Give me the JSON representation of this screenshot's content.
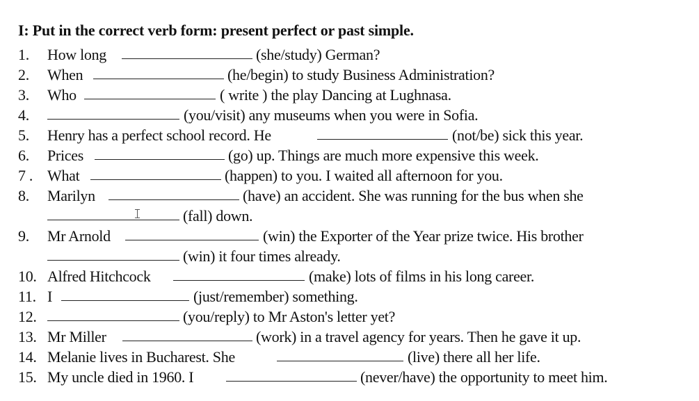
{
  "worksheet": {
    "title": "I:  Put in the correct verb form: present perfect or past simple.",
    "items": [
      {
        "number": "1.",
        "before": "How long",
        "hint": "(she/study) German?"
      },
      {
        "number": "2.",
        "before": "When",
        "hint": "(he/begin) to study Business Administration?"
      },
      {
        "number": "3.",
        "before": "Who",
        "hint": "( write ) the play Dancing at Lughnasa."
      },
      {
        "number": "4.",
        "before": "",
        "hint": "(you/visit) any museums when you were in Sofia."
      },
      {
        "number": "5.",
        "before": "Henry has a perfect school record. He",
        "hint": "(not/be) sick this year."
      },
      {
        "number": "6.",
        "before": "Prices",
        "hint": "(go) up. Things are much more expensive this week."
      },
      {
        "number": "7 .",
        "before": "What",
        "hint": "(happen) to you. I waited all afternoon for you."
      },
      {
        "number": "8.",
        "before": "Marilyn",
        "hint": "(have) an accident. She was running for the bus when she",
        "continuation_hint": "(fall) down."
      },
      {
        "number": "9.",
        "before": "Mr Arnold",
        "hint": "(win) the Exporter of the Year prize twice. His brother",
        "continuation_hint": "(win) it four times already."
      },
      {
        "number": "10.",
        "before": "Alfred Hitchcock",
        "hint": "(make) lots of films in his long career."
      },
      {
        "number": "11.",
        "before": "I",
        "hint": "(just/remember) something."
      },
      {
        "number": "12.",
        "before": "",
        "hint": "(you/reply) to Mr Aston's letter yet?"
      },
      {
        "number": "13.",
        "before": "Mr Miller",
        "hint": "(work) in a travel agency for years. Then he gave it up."
      },
      {
        "number": "14.",
        "before": "Melanie lives in Bucharest. She",
        "hint": "(live) there all her life."
      },
      {
        "number": "15.",
        "before": "My uncle died in 1960. I",
        "hint": "(never/have) the opportunity to meet him."
      }
    ],
    "answers": [
      "",
      "",
      "",
      "",
      "",
      "",
      "",
      "",
      "",
      "",
      "",
      "",
      "",
      "",
      "",
      "",
      ""
    ],
    "cursor_icon": "text-cursor-ibeam-icon"
  }
}
